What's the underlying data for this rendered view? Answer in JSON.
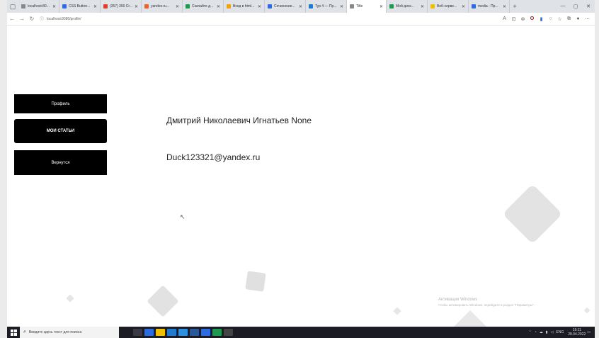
{
  "browser": {
    "tabs": [
      {
        "label": "localhost:80...",
        "color": "#888888"
      },
      {
        "label": "CSS Button...",
        "color": "#2d6be0"
      },
      {
        "label": "(357) 350 Cr...",
        "color": "#e33b2e"
      },
      {
        "label": "yandex.ru...",
        "color": "#e8642c"
      },
      {
        "label": "Скачайте д...",
        "color": "#1d9a4f"
      },
      {
        "label": "Вход в html...",
        "color": "#f0a30a"
      },
      {
        "label": "Сочинение...",
        "color": "#2d6be0"
      },
      {
        "label": "Тур 4 — Пр...",
        "color": "#1e7bd0"
      },
      {
        "label": "Title",
        "color": "#888888"
      },
      {
        "label": "Мой диск...",
        "color": "#1d9a4f"
      },
      {
        "label": "Веб-серве...",
        "color": "#f0c000"
      },
      {
        "label": "media - Пр...",
        "color": "#2d6be0"
      }
    ],
    "url": "localhost:8080/profile/"
  },
  "sidebar": {
    "profile_label": "Профиль",
    "articles_label": "МОИ СТАТЬИ",
    "back_label": "Вернутся"
  },
  "profile": {
    "full_name": "Дмитрий Николаевич Игнатьев None",
    "email": "Duck123321@yandex.ru"
  },
  "watermark": {
    "title": "Активация Windows",
    "subtitle": "Чтобы активировать Windows, перейдите в раздел \"Параметры\"."
  },
  "taskbar": {
    "search_placeholder": "Введите здесь текст для поиска",
    "time": "19:11",
    "date": "28.04.2022",
    "lang": "ENG",
    "app_colors": [
      "#3a3a44",
      "#2d6be0",
      "#f0c000",
      "#1e7bd0",
      "#2d8fe0",
      "#2b579a",
      "#2d6be0",
      "#1d9a4f",
      "#444444"
    ]
  }
}
